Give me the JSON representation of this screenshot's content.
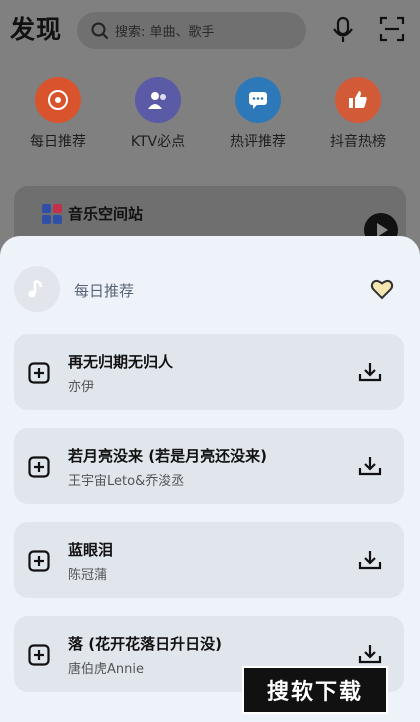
{
  "header": {
    "title": "发现",
    "search_placeholder": "搜索: 单曲、歌手",
    "mic_icon": "microphone-icon",
    "scan_icon": "scan-icon"
  },
  "quick_links": [
    {
      "label": "每日推荐",
      "icon": "vinyl-icon",
      "color": "#d9532c"
    },
    {
      "label": "KTV必点",
      "icon": "users-icon",
      "color": "#5a5aa6"
    },
    {
      "label": "热评推荐",
      "icon": "comment-icon",
      "color": "#2c78b8"
    },
    {
      "label": "抖音热榜",
      "icon": "thumbs-up-icon",
      "color": "#d35a36"
    }
  ],
  "station": {
    "label": "音乐空间站"
  },
  "sheet": {
    "title": "每日推荐",
    "songs": [
      {
        "name": "再无归期无归人",
        "artist": "亦伊"
      },
      {
        "name": "若月亮没来 (若是月亮还没来)",
        "artist": "王宇宙Leto&乔浚丞"
      },
      {
        "name": "蓝眼泪",
        "artist": "陈冠蒲"
      },
      {
        "name": "落 (花开花落日升日没)",
        "artist": "唐伯虎Annie"
      }
    ]
  },
  "watermark": "搜软下载",
  "colors": {
    "overlay": "#808080",
    "sheet_bg": "#eef3fa",
    "card_bg": "#e1e6ed"
  }
}
